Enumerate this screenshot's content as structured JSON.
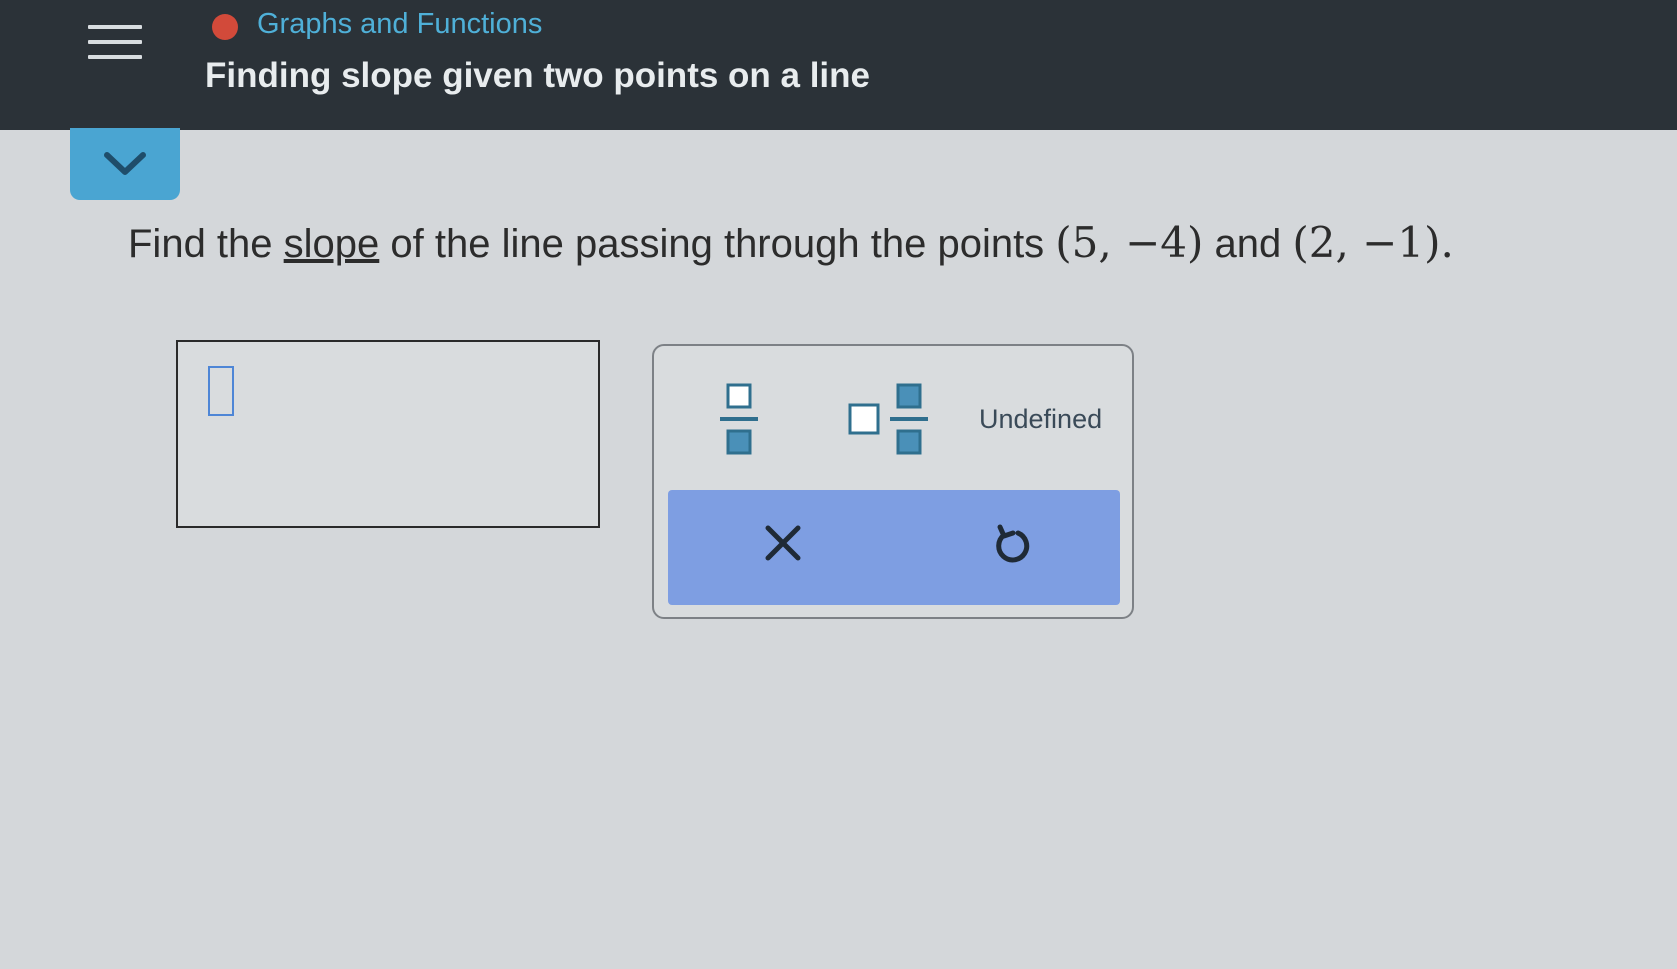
{
  "header": {
    "topic": "Graphs and Functions",
    "title": "Finding slope given two points on a line"
  },
  "question": {
    "prefix": "Find the ",
    "link": "slope",
    "middle": " of the line passing through the points ",
    "point1": "(5, −4)",
    "conjunction": " and ",
    "point2": "(2, −1)",
    "end": "."
  },
  "keypad": {
    "keys": [
      "fraction-icon",
      "mixed-number-icon"
    ],
    "undefined_label": "Undefined",
    "actions": [
      "clear-icon",
      "undo-icon"
    ]
  },
  "colors": {
    "header_bg": "#2b3238",
    "accent": "#4aa5d2",
    "action_bar": "#7e9ee2",
    "topic_dot": "#d24a3a"
  }
}
